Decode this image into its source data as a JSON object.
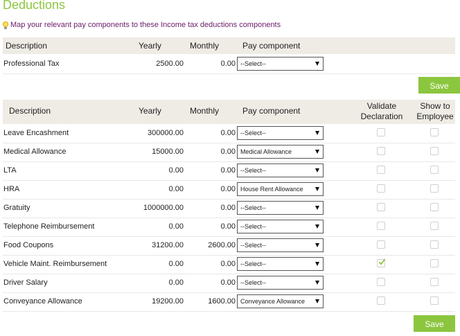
{
  "title": "Deductions",
  "hint": "Map your relevant pay components to these Income tax deductions components",
  "table1": {
    "headers": {
      "description": "Description",
      "yearly": "Yearly",
      "monthly": "Monthly",
      "pay_component": "Pay component"
    },
    "rows": [
      {
        "description": "Professional Tax",
        "yearly": "2500.00",
        "monthly": "0.00",
        "pay_component": "--Select--"
      }
    ],
    "save_label": "Save"
  },
  "table2": {
    "headers": {
      "description": "Description",
      "yearly": "Yearly",
      "monthly": "Monthly",
      "pay_component": "Pay component",
      "validate_1": "Validate",
      "validate_2": "Declaration",
      "show_1": "Show to",
      "show_2": "Employee"
    },
    "rows": [
      {
        "description": "Leave Encashment",
        "yearly": "300000.00",
        "monthly": "0.00",
        "pay_component": "--Select--",
        "validate": false,
        "show": false
      },
      {
        "description": "Medical Allowance",
        "yearly": "15000.00",
        "monthly": "0.00",
        "pay_component": "Medical Allowance",
        "validate": false,
        "show": false
      },
      {
        "description": "LTA",
        "yearly": "0.00",
        "monthly": "0.00",
        "pay_component": "--Select--",
        "validate": false,
        "show": false
      },
      {
        "description": "HRA",
        "yearly": "0.00",
        "monthly": "0.00",
        "pay_component": "House Rent Allowance",
        "validate": false,
        "show": false
      },
      {
        "description": "Gratuity",
        "yearly": "1000000.00",
        "monthly": "0.00",
        "pay_component": "--Select--",
        "validate": false,
        "show": false
      },
      {
        "description": "Telephone Reimbursement",
        "yearly": "0.00",
        "monthly": "0.00",
        "pay_component": "--Select--",
        "validate": false,
        "show": false
      },
      {
        "description": "Food Coupons",
        "yearly": "31200.00",
        "monthly": "2600.00",
        "pay_component": "--Select--",
        "validate": false,
        "show": false
      },
      {
        "description": "Vehicle Maint. Reimbursement",
        "yearly": "0.00",
        "monthly": "0.00",
        "pay_component": "--Select--",
        "validate": true,
        "show": false
      },
      {
        "description": "Driver Salary",
        "yearly": "0.00",
        "monthly": "0.00",
        "pay_component": "--Select--",
        "validate": false,
        "show": false
      },
      {
        "description": "Conveyance Allowance",
        "yearly": "19200.00",
        "monthly": "1600.00",
        "pay_component": "Conveyance Allowance",
        "validate": false,
        "show": false
      }
    ],
    "save_label": "Save"
  },
  "colors": {
    "accent": "#8cc63f",
    "header_bg": "#efebe5",
    "hint_text": "#6a1b6a",
    "check": "#8cc63f"
  }
}
